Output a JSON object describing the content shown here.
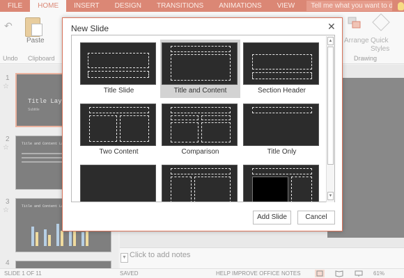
{
  "ribbon": {
    "tabs": [
      "FILE",
      "HOME",
      "INSERT",
      "DESIGN",
      "TRANSITIONS",
      "ANIMATIONS",
      "VIEW"
    ],
    "active_tab": "HOME",
    "tell_me_placeholder": "Tell me what you want to do",
    "paste_label": "Paste",
    "undo_group": "Undo",
    "clipboard_group": "Clipboard",
    "arrange_label": "Arrange",
    "quick_styles_label": "Quick Styles",
    "drawing_group": "Drawing"
  },
  "slides_panel": {
    "slides": [
      {
        "number": "1",
        "title": "Title Layout",
        "subtitle": "Subtitle"
      },
      {
        "number": "2",
        "title": "Title and Content Layout"
      },
      {
        "number": "3",
        "title": "Title and Content Layout"
      },
      {
        "number": "4"
      }
    ]
  },
  "notes_placeholder": "Click to add notes",
  "dialog": {
    "title": "New Slide",
    "layouts": [
      {
        "label": "Title Slide",
        "selected": false
      },
      {
        "label": "Title and Content",
        "selected": true
      },
      {
        "label": "Section Header",
        "selected": false
      },
      {
        "label": "Two Content",
        "selected": false
      },
      {
        "label": "Comparison",
        "selected": false
      },
      {
        "label": "Title Only",
        "selected": false
      },
      {
        "label": "",
        "selected": false
      },
      {
        "label": "",
        "selected": false
      },
      {
        "label": "",
        "selected": false
      }
    ],
    "add_button": "Add Slide",
    "cancel_button": "Cancel"
  },
  "statusbar": {
    "slide_counter": "SLIDE 1 OF 11",
    "save_state": "SAVED",
    "help_link": "HELP IMPROVE OFFICE",
    "notes_label": "NOTES",
    "zoom": "61%"
  },
  "colors": {
    "accent": "#c8472b",
    "dialog_border": "#d9735a",
    "slide_bg": "#2c2c2c"
  }
}
